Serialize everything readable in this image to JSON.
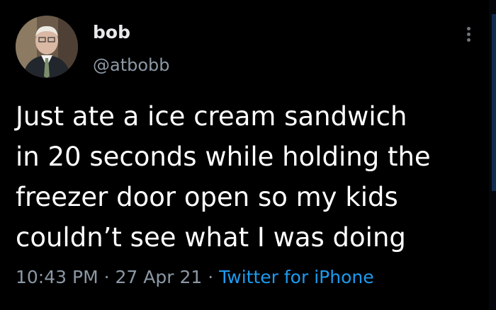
{
  "author": {
    "name": "bob",
    "handle": "@atbobb",
    "avatar_icon": "profile-photo"
  },
  "menu": {
    "icon": "more-vertical-icon"
  },
  "tweet": {
    "text": "Just ate a ice cream sandwich\nin 20 seconds while holding the\nfreezer door open so my kids\ncouldn’t see what I was doing",
    "time": "10:43 PM",
    "separator": "·",
    "date": "27 Apr 21",
    "source": "Twitter for iPhone"
  },
  "colors": {
    "background": "#000000",
    "primary_text": "#ffffff",
    "secondary_text": "#8b98a5",
    "link": "#1d9bf0"
  }
}
